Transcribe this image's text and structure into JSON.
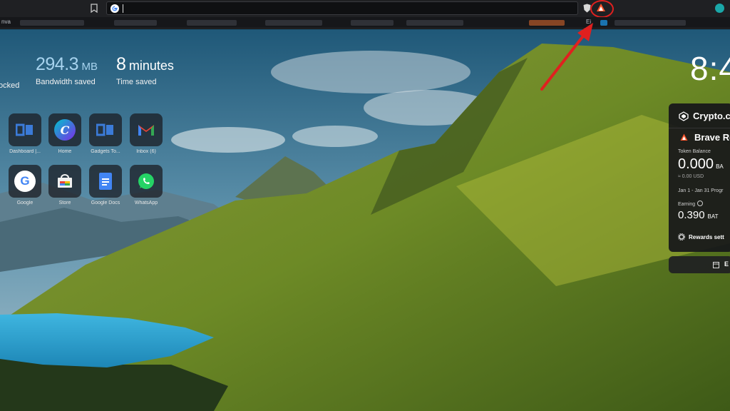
{
  "browser": {
    "bookmarks_bar": {
      "left_label": "nva",
      "right_label": "Ei"
    }
  },
  "stats": [
    {
      "value": "",
      "unit": "",
      "label": "ocked"
    },
    {
      "value": "294.3",
      "unit": "MB",
      "label": "Bandwidth saved"
    },
    {
      "value": "8",
      "unit": "minutes",
      "label": "Time saved"
    }
  ],
  "clock": "8:4",
  "tiles": [
    {
      "caption": "Dashboard |...",
      "icon": "gadgets-logo-icon"
    },
    {
      "caption": "Home",
      "icon": "canva-logo-icon"
    },
    {
      "caption": "Gadgets To...",
      "icon": "gadgets-logo-icon"
    },
    {
      "caption": "Inbox (6)",
      "icon": "gmail-icon"
    },
    {
      "caption": "Google",
      "icon": "google-icon"
    },
    {
      "caption": "Store",
      "icon": "store-icon"
    },
    {
      "caption": "Google Docs",
      "icon": "docs-icon"
    },
    {
      "caption": "WhatsApp",
      "icon": "whatsapp-icon"
    }
  ],
  "rewards": {
    "crypto_title": "Crypto.c",
    "brave_title": "Brave Re",
    "token_balance_label": "Token Balance",
    "balance_value": "0.000",
    "balance_unit": "BA",
    "usd_value": "≈ 0.00 USD",
    "period": "Jan 1 - Jan 31 Progr",
    "earning_label": "Earning",
    "earning_value": "0.390",
    "earning_unit": "BAT",
    "settings_label": "Rewards sett",
    "bottom_label": "E"
  },
  "colors": {
    "stat_accent": "#a7d3ee",
    "highlight_red": "#e0201f",
    "brave_orange": "#fb542b"
  }
}
